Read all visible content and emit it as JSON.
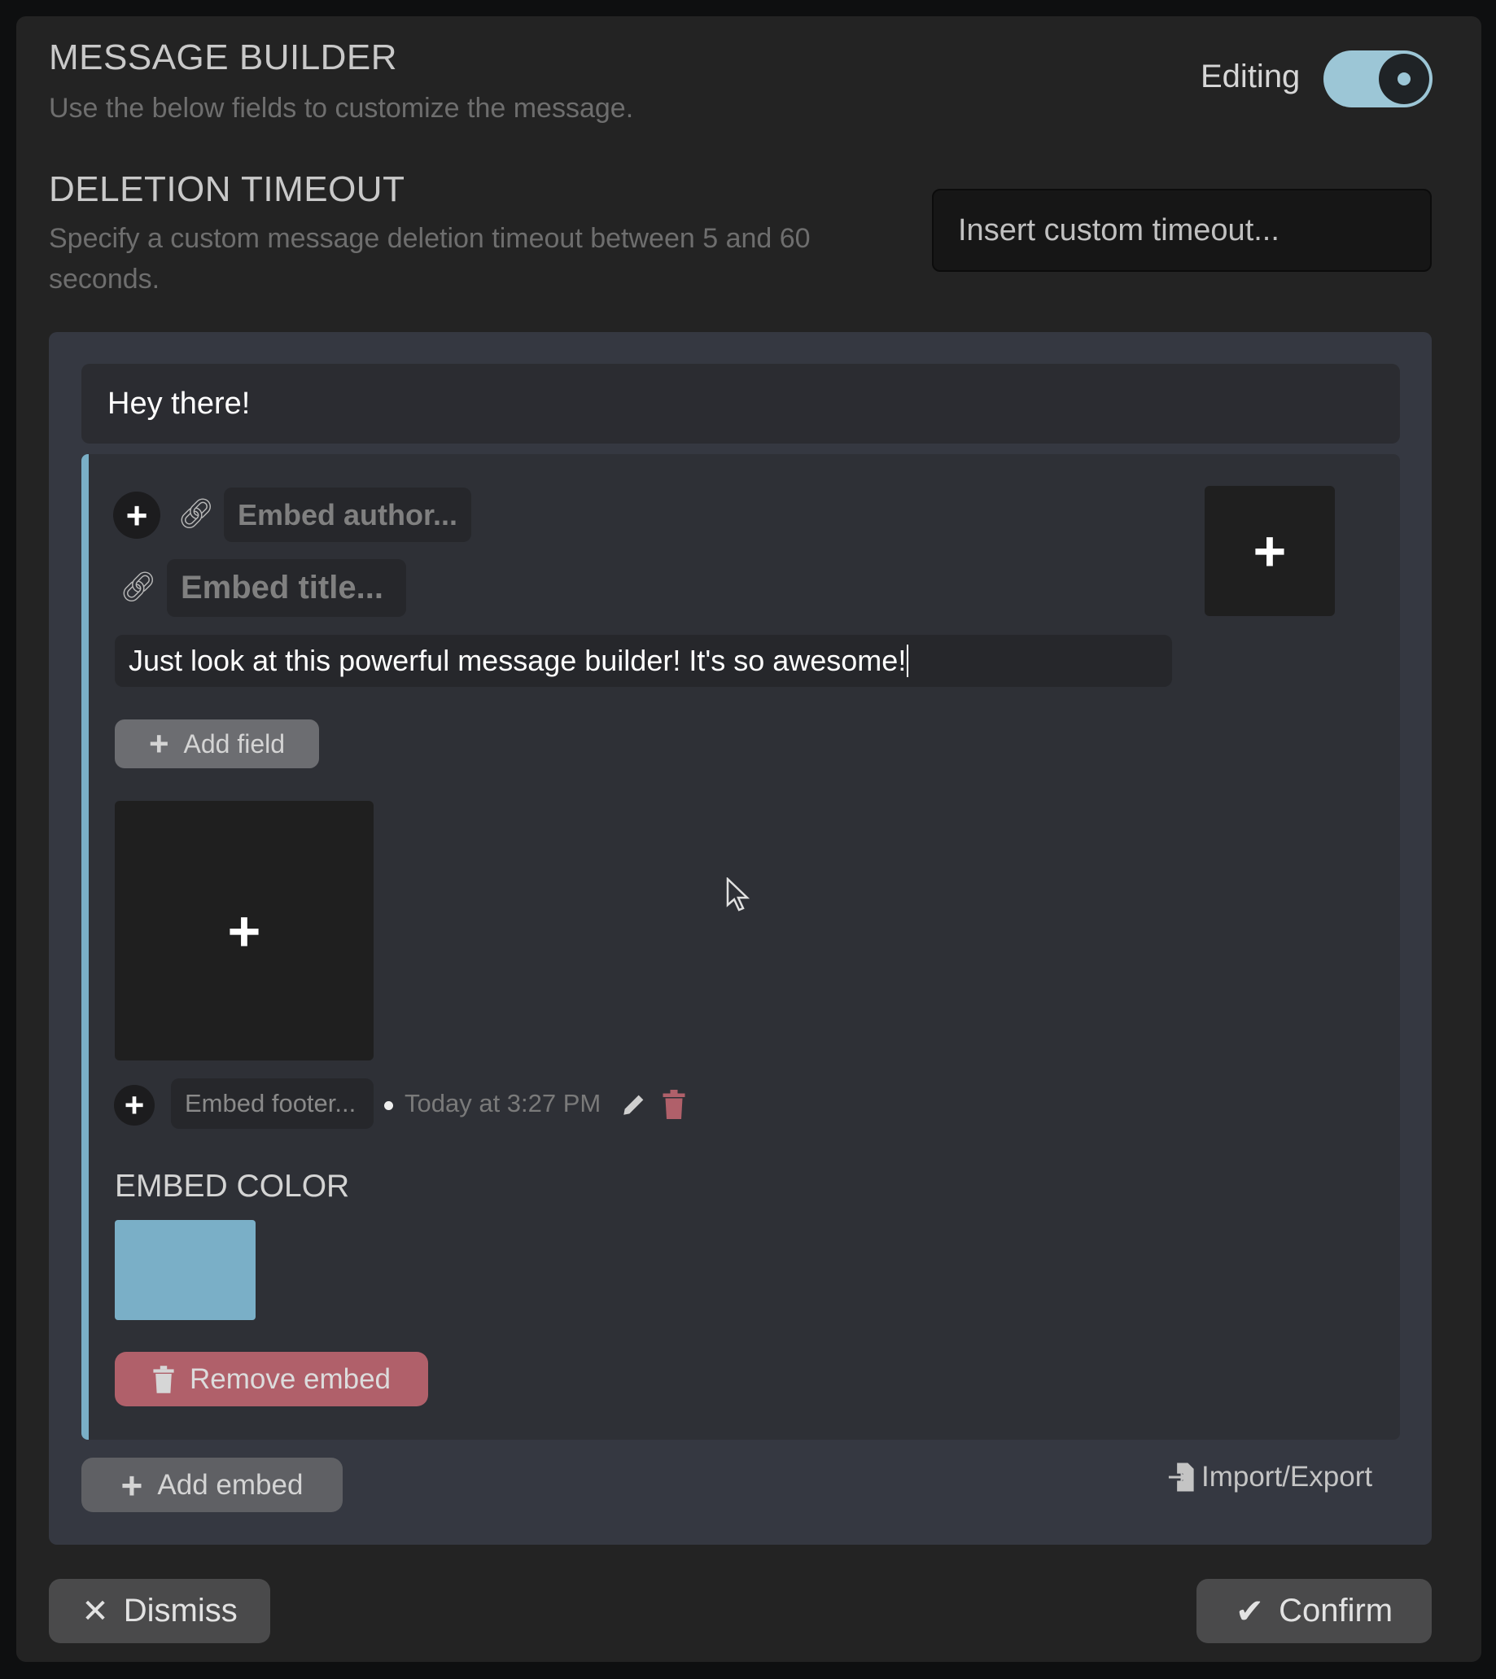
{
  "header": {
    "title": "MESSAGE BUILDER",
    "subtitle": "Use the below fields to customize the message.",
    "toggle_label": "Editing",
    "toggle_on": true
  },
  "timeout": {
    "title": "DELETION TIMEOUT",
    "description": "Specify a custom message deletion timeout between 5 and 60 seconds.",
    "placeholder": "Insert custom timeout..."
  },
  "message": {
    "content": "Hey there!"
  },
  "embed": {
    "author_placeholder": "Embed author...",
    "title_placeholder": "Embed title...",
    "description": "Just look at this powerful message builder! It's so awesome!",
    "add_field_label": "Add field",
    "footer_placeholder": "Embed footer...",
    "timestamp": "Today at 3:27 PM",
    "color_label": "EMBED COLOR",
    "color": "#7aafc7",
    "remove_label": "Remove embed"
  },
  "actions": {
    "add_embed": "Add embed",
    "import_export": "Import/Export",
    "dismiss": "Dismiss",
    "confirm": "Confirm"
  },
  "colors": {
    "accent": "#7aafc7",
    "danger": "#b0606a",
    "modal_bg": "#232323",
    "builder_bg": "#353841"
  }
}
